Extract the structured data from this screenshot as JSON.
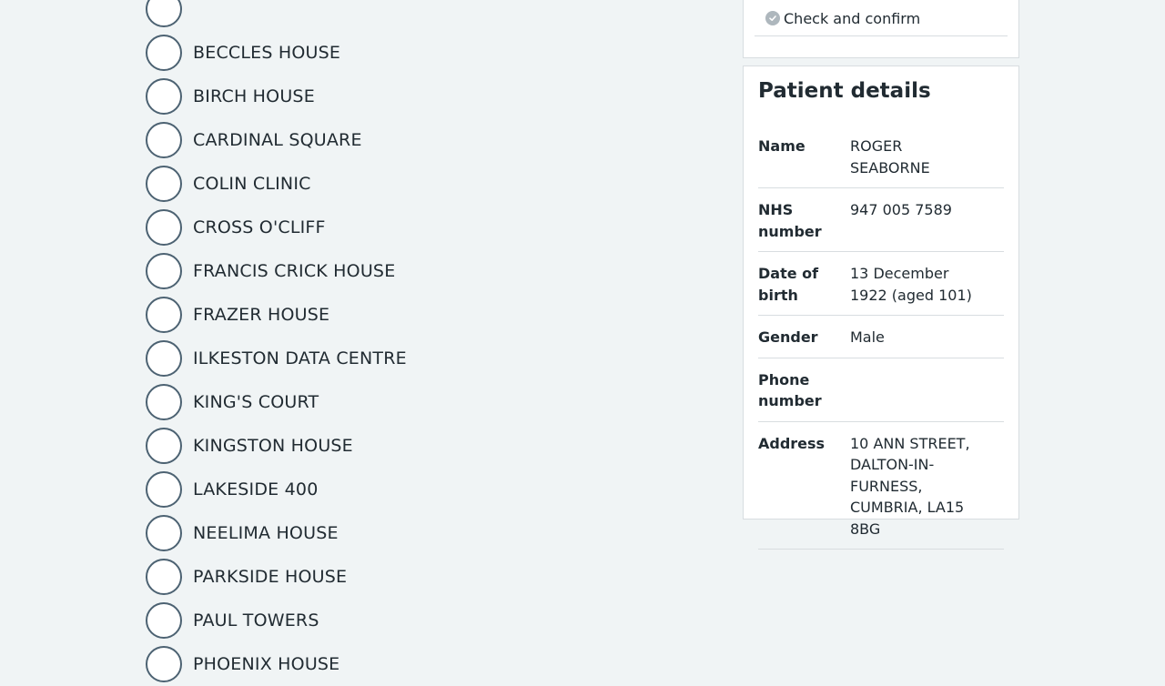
{
  "locations": {
    "options": [
      {
        "label": ""
      },
      {
        "label": "BECCLES HOUSE"
      },
      {
        "label": "BIRCH HOUSE"
      },
      {
        "label": "CARDINAL SQUARE"
      },
      {
        "label": "COLIN CLINIC"
      },
      {
        "label": "CROSS O'CLIFF"
      },
      {
        "label": "FRANCIS CRICK HOUSE"
      },
      {
        "label": "FRAZER HOUSE"
      },
      {
        "label": "ILKESTON DATA CENTRE"
      },
      {
        "label": "KING'S COURT"
      },
      {
        "label": "KINGSTON HOUSE"
      },
      {
        "label": "LAKESIDE 400"
      },
      {
        "label": "NEELIMA HOUSE"
      },
      {
        "label": "PARKSIDE HOUSE"
      },
      {
        "label": "PAUL TOWERS"
      },
      {
        "label": "PHOENIX HOUSE"
      }
    ]
  },
  "steps": {
    "check_confirm": {
      "label": "Check and confirm",
      "icon": "check-circle-icon",
      "icon_color": "#aeb7bd"
    }
  },
  "patient": {
    "title": "Patient details",
    "rows": [
      {
        "key": "Name",
        "value": "ROGER SEABORNE"
      },
      {
        "key": "NHS number",
        "value": "947 005 7589"
      },
      {
        "key": "Date of birth",
        "value": "13 December 1922 (aged 101)"
      },
      {
        "key": "Gender",
        "value": "Male"
      },
      {
        "key": "Phone number",
        "value": ""
      },
      {
        "key": "Address",
        "value": "10 ANN STREET, DALTON-IN-FURNESS, CUMBRIA, LA15 8BG"
      }
    ]
  },
  "colors": {
    "page_background": "#f0f4f5",
    "text": "#212b32",
    "radio_border": "#4c6272",
    "card_border": "#d8dde0"
  }
}
